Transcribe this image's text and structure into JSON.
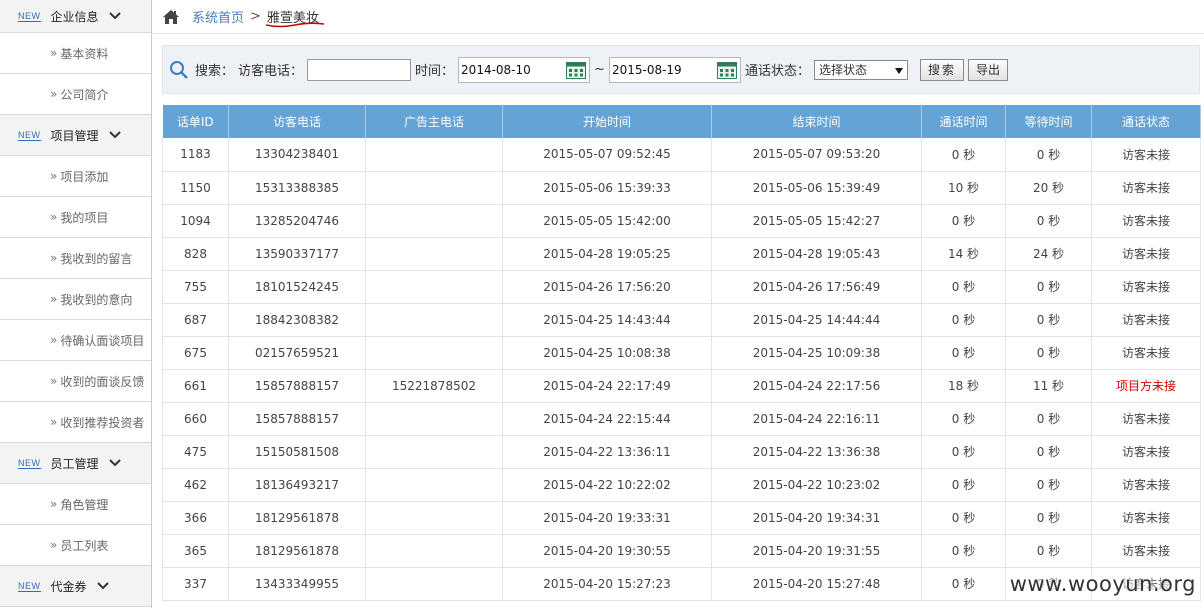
{
  "sidebar": {
    "new_badge": "NEW",
    "sections": [
      {
        "title": "企业信息",
        "items": [
          "基本资料",
          "公司简介"
        ]
      },
      {
        "title": "项目管理",
        "items": [
          "项目添加",
          "我的项目",
          "我收到的留言",
          "我收到的意向",
          "待确认面谈项目",
          "收到的面谈反馈",
          "收到推荐投资者"
        ]
      },
      {
        "title": "员工管理",
        "items": [
          "角色管理",
          "员工列表"
        ]
      },
      {
        "title": "代金券",
        "items": []
      }
    ]
  },
  "breadcrumb": {
    "home": "系统首页",
    "sep": ">",
    "current": "雅萱美妆"
  },
  "search": {
    "label": "搜索：",
    "phone_label": "访客电话：",
    "phone_value": "",
    "time_label": "时间：",
    "date_from": "2014-08-10",
    "tilde": "~",
    "date_to": "2015-08-19",
    "status_label": "通话状态：",
    "status_value": "选择状态",
    "search_btn": "搜索",
    "export_btn": "导出"
  },
  "table": {
    "headers": [
      "话单ID",
      "访客电话",
      "广告主电话",
      "开始时间",
      "结束时间",
      "通话时间",
      "等待时间",
      "通话状态"
    ],
    "rows": [
      [
        "1183",
        "13304238401",
        "",
        "2015-05-07 09:52:45",
        "2015-05-07 09:53:20",
        "0 秒",
        "0 秒",
        "访客未接"
      ],
      [
        "1150",
        "15313388385",
        "",
        "2015-05-06 15:39:33",
        "2015-05-06 15:39:49",
        "10 秒",
        "20 秒",
        "访客未接"
      ],
      [
        "1094",
        "13285204746",
        "",
        "2015-05-05 15:42:00",
        "2015-05-05 15:42:27",
        "0 秒",
        "0 秒",
        "访客未接"
      ],
      [
        "828",
        "13590337177",
        "",
        "2015-04-28 19:05:25",
        "2015-04-28 19:05:43",
        "14 秒",
        "24 秒",
        "访客未接"
      ],
      [
        "755",
        "18101524245",
        "",
        "2015-04-26 17:56:20",
        "2015-04-26 17:56:49",
        "0 秒",
        "0 秒",
        "访客未接"
      ],
      [
        "687",
        "18842308382",
        "",
        "2015-04-25 14:43:44",
        "2015-04-25 14:44:44",
        "0 秒",
        "0 秒",
        "访客未接"
      ],
      [
        "675",
        "02157659521",
        "",
        "2015-04-25 10:08:38",
        "2015-04-25 10:09:38",
        "0 秒",
        "0 秒",
        "访客未接"
      ],
      [
        "661",
        "15857888157",
        "15221878502",
        "2015-04-24 22:17:49",
        "2015-04-24 22:17:56",
        "18 秒",
        "11 秒",
        "项目方未接"
      ],
      [
        "660",
        "15857888157",
        "",
        "2015-04-24 22:15:44",
        "2015-04-24 22:16:11",
        "0 秒",
        "0 秒",
        "访客未接"
      ],
      [
        "475",
        "15150581508",
        "",
        "2015-04-22 13:36:11",
        "2015-04-22 13:36:38",
        "0 秒",
        "0 秒",
        "访客未接"
      ],
      [
        "462",
        "18136493217",
        "",
        "2015-04-22 10:22:02",
        "2015-04-22 10:23:02",
        "0 秒",
        "0 秒",
        "访客未接"
      ],
      [
        "366",
        "18129561878",
        "",
        "2015-04-20 19:33:31",
        "2015-04-20 19:34:31",
        "0 秒",
        "0 秒",
        "访客未接"
      ],
      [
        "365",
        "18129561878",
        "",
        "2015-04-20 19:30:55",
        "2015-04-20 19:31:55",
        "0 秒",
        "0 秒",
        "访客未接"
      ],
      [
        "337",
        "13433349955",
        "",
        "2015-04-20 15:27:23",
        "2015-04-20 15:27:48",
        "0 秒",
        "0 秒",
        "访客未接"
      ]
    ],
    "alert_status": "项目方未接",
    "alert_color": "#d60000"
  },
  "watermark": "www.wooyun.org",
  "colors": {
    "header_blue": "#63a3d5",
    "link_blue": "#4a7cc2",
    "underline_red": "#d00000"
  }
}
